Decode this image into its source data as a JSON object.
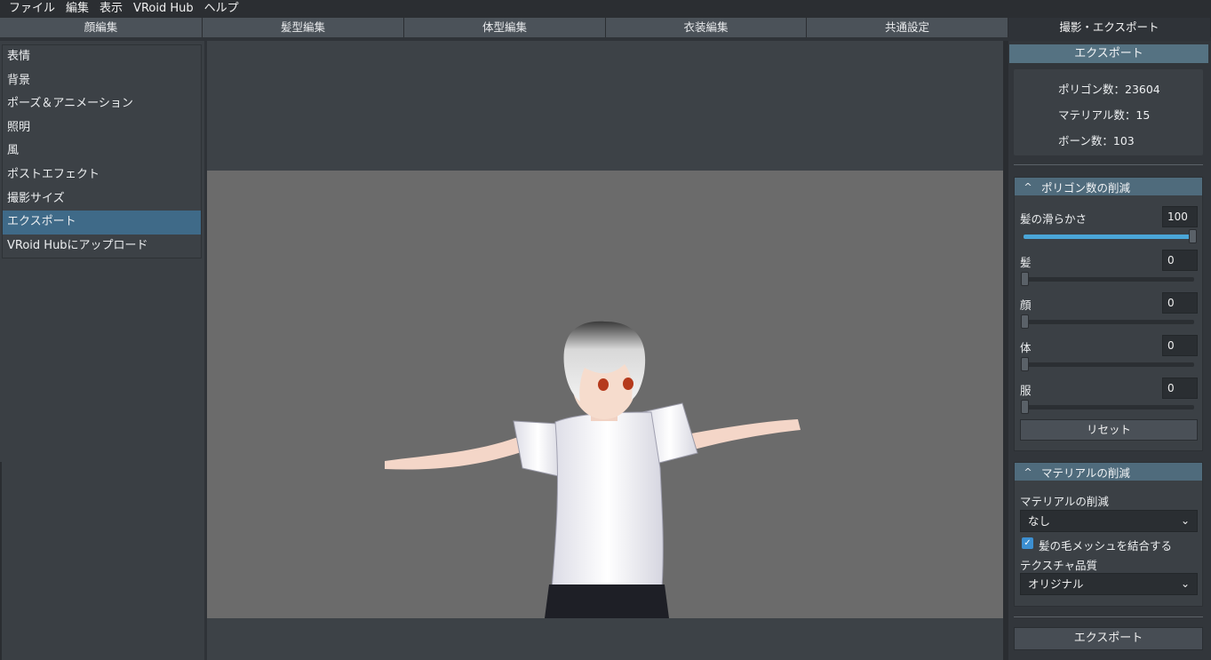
{
  "menu": [
    "ファイル",
    "編集",
    "表示",
    "VRoid Hub",
    "ヘルプ"
  ],
  "tabs": [
    "顔編集",
    "髪型編集",
    "体型編集",
    "衣装編集",
    "共通設定",
    "撮影・エクスポート"
  ],
  "left_list": [
    "表情",
    "背景",
    "ポーズ＆アニメーション",
    "照明",
    "風",
    "ポストエフェクト",
    "撮影サイズ",
    "エクスポート",
    "VRoid Hubにアップロード"
  ],
  "right": {
    "header": "エクスポート",
    "stats": [
      "ポリゴン数：23604",
      "マテリアル数：15",
      "ボーン数：103"
    ],
    "poly_section": {
      "title": "ポリゴン数の削減",
      "sliders": [
        {
          "label": "髪の滑らかさ",
          "value": "100",
          "fraction": 1.0
        },
        {
          "label": "髪",
          "value": "0",
          "fraction": 0
        },
        {
          "label": "顔",
          "value": "0",
          "fraction": 0
        },
        {
          "label": "体",
          "value": "0",
          "fraction": 0
        },
        {
          "label": "服",
          "value": "0",
          "fraction": 0
        }
      ],
      "reset": "リセット"
    },
    "material_section": {
      "title": "マテリアルの削減",
      "mat_label": "マテリアルの削減",
      "mat_value": "なし",
      "checkbox_label": "髪の毛メッシュを結合する",
      "tex_label": "テクスチャ品質",
      "tex_value": "オリジナル"
    },
    "export_button": "エクスポート"
  },
  "icons": {
    "chevron_up": "^",
    "chevron_down": "⌄",
    "check": "✓"
  }
}
